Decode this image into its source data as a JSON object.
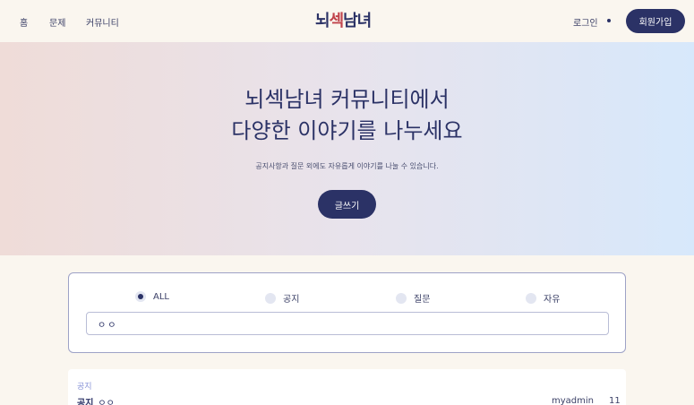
{
  "nav": {
    "home": "홈",
    "problems": "문제",
    "community": "커뮤니티",
    "logo_part1": "뇌",
    "logo_part2": "섹",
    "logo_part3": "남녀",
    "login": "로그인",
    "signup": "회원가입"
  },
  "hero": {
    "title_line1": "뇌섹남녀 커뮤니티에서",
    "title_line2": "다양한 이야기를 나누세요",
    "subtitle": "공지사항과 질문 외에도 자유롭게 이야기를 나눌 수 있습니다.",
    "write_button": "글쓰기"
  },
  "filter": {
    "options": [
      "ALL",
      "공지",
      "질문",
      "자유"
    ],
    "selected": "ALL",
    "search_value": "ㅇㅇ"
  },
  "posts": [
    {
      "category": "공지",
      "tag": "공지",
      "title": "ㅇㅇ",
      "author": "myadmin",
      "count": "11"
    }
  ],
  "colors": {
    "primary": "#2b3266",
    "accent": "#c0434b",
    "background": "#faf6ef"
  }
}
